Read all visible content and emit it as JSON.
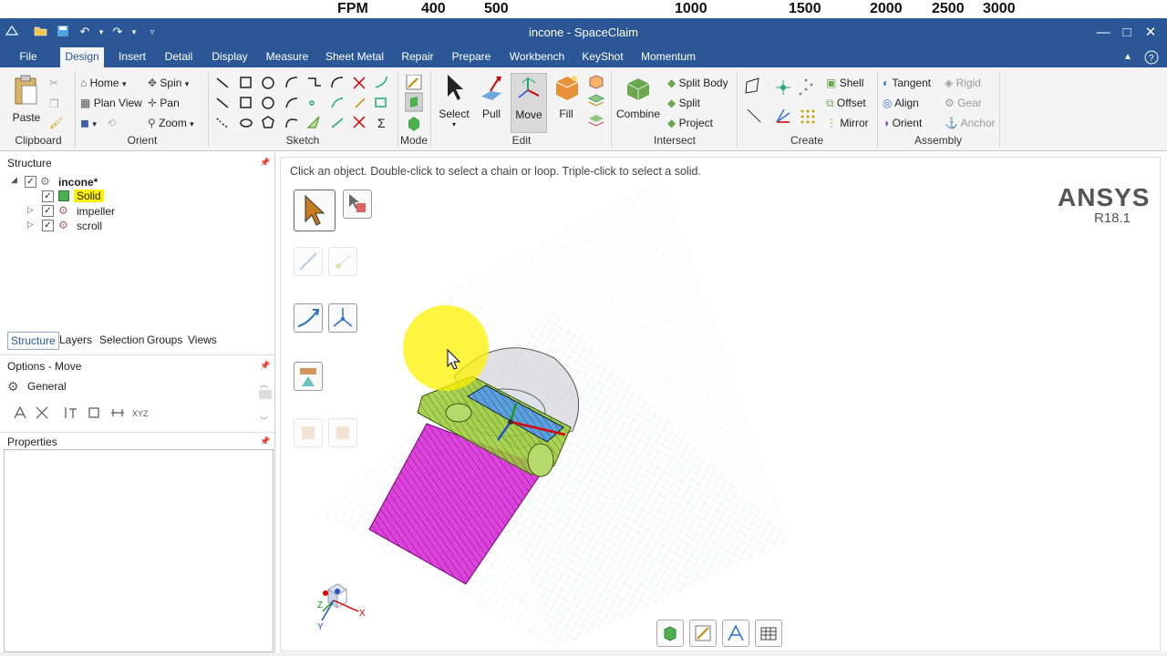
{
  "fpm": {
    "label": "FPM",
    "ticks": [
      "400",
      "500",
      "1000",
      "1500",
      "2000",
      "2500",
      "3000"
    ]
  },
  "titlebar": {
    "title": "incone - SpaceClaim"
  },
  "menu": {
    "tabs": [
      "File",
      "Design",
      "Insert",
      "Detail",
      "Display",
      "Measure",
      "Sheet Metal",
      "Repair",
      "Prepare",
      "Workbench",
      "KeyShot",
      "Momentum"
    ],
    "active": "Design"
  },
  "ribbon": {
    "clipboard": {
      "paste": "Paste",
      "group": "Clipboard"
    },
    "orient": {
      "home": "Home",
      "plan_view": "Plan View",
      "spin": "Spin",
      "pan": "Pan",
      "zoom": "Zoom",
      "group": "Orient"
    },
    "sketch": {
      "group": "Sketch"
    },
    "mode": {
      "group": "Mode"
    },
    "edit": {
      "select": "Select",
      "pull": "Pull",
      "move": "Move",
      "fill": "Fill",
      "group": "Edit"
    },
    "intersect": {
      "combine": "Combine",
      "split_body": "Split Body",
      "split": "Split",
      "project": "Project",
      "group": "Intersect"
    },
    "create": {
      "shell": "Shell",
      "offset": "Offset",
      "mirror": "Mirror",
      "group": "Create"
    },
    "assembly": {
      "tangent": "Tangent",
      "align": "Align",
      "orient": "Orient",
      "rigid": "Rigid",
      "gear": "Gear",
      "anchor": "Anchor",
      "group": "Assembly"
    }
  },
  "structure": {
    "title": "Structure",
    "root": "incone*",
    "items": [
      {
        "label": "Solid",
        "highlighted": true
      },
      {
        "label": "impeller",
        "highlighted": false
      },
      {
        "label": "scroll",
        "highlighted": false
      }
    ]
  },
  "panel_tabs": {
    "tabs": [
      "Structure",
      "Layers",
      "Selection",
      "Groups",
      "Views"
    ],
    "active": "Structure"
  },
  "options": {
    "title": "Options - Move",
    "section": "General"
  },
  "properties": {
    "title": "Properties"
  },
  "viewport": {
    "hint": "Click an object.  Double-click to select a chain or loop.  Triple-click to select a solid.",
    "brand": "ANSYS",
    "version": "R18.1",
    "axes": {
      "x": "X",
      "y": "Y",
      "z": "Z"
    }
  },
  "colors": {
    "chrome": "#2b5797",
    "highlight": "#fff200",
    "solid": "#e040e0",
    "part_green": "#9acd32",
    "part_blue": "#5aa0e0"
  }
}
